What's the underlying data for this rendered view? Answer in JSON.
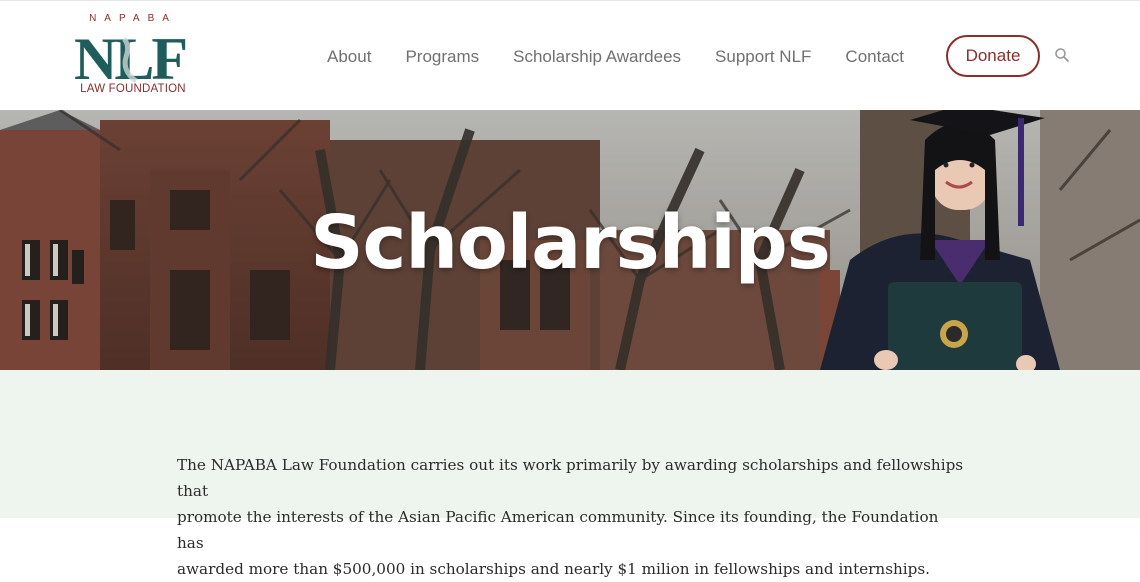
{
  "logo": {
    "top_text": "NAPABA",
    "mark_text": "NLF",
    "bottom_text": "LAW FOUNDATION",
    "colors": {
      "teal": "#1f5d5c",
      "maroon": "#8a2e2c"
    }
  },
  "nav": {
    "items": [
      {
        "label": "About"
      },
      {
        "label": "Programs"
      },
      {
        "label": "Scholarship Awardees"
      },
      {
        "label": "Support NLF"
      },
      {
        "label": "Contact"
      }
    ],
    "donate_label": "Donate",
    "search_icon": "search-icon"
  },
  "hero": {
    "title": "Scholarships"
  },
  "content": {
    "intro_lines": [
      "The NAPABA Law Foundation carries out its work primarily by awarding scholarships and fellowships that",
      "promote the interests of the Asian Pacific American community. Since its founding, the Foundation has",
      "awarded more than $500,000 in scholarships and nearly $1 milion in fellowships and internships."
    ]
  },
  "colors": {
    "accent": "#8a2e2c",
    "nav_text": "#707070",
    "content_bg": "#eef4ee"
  }
}
